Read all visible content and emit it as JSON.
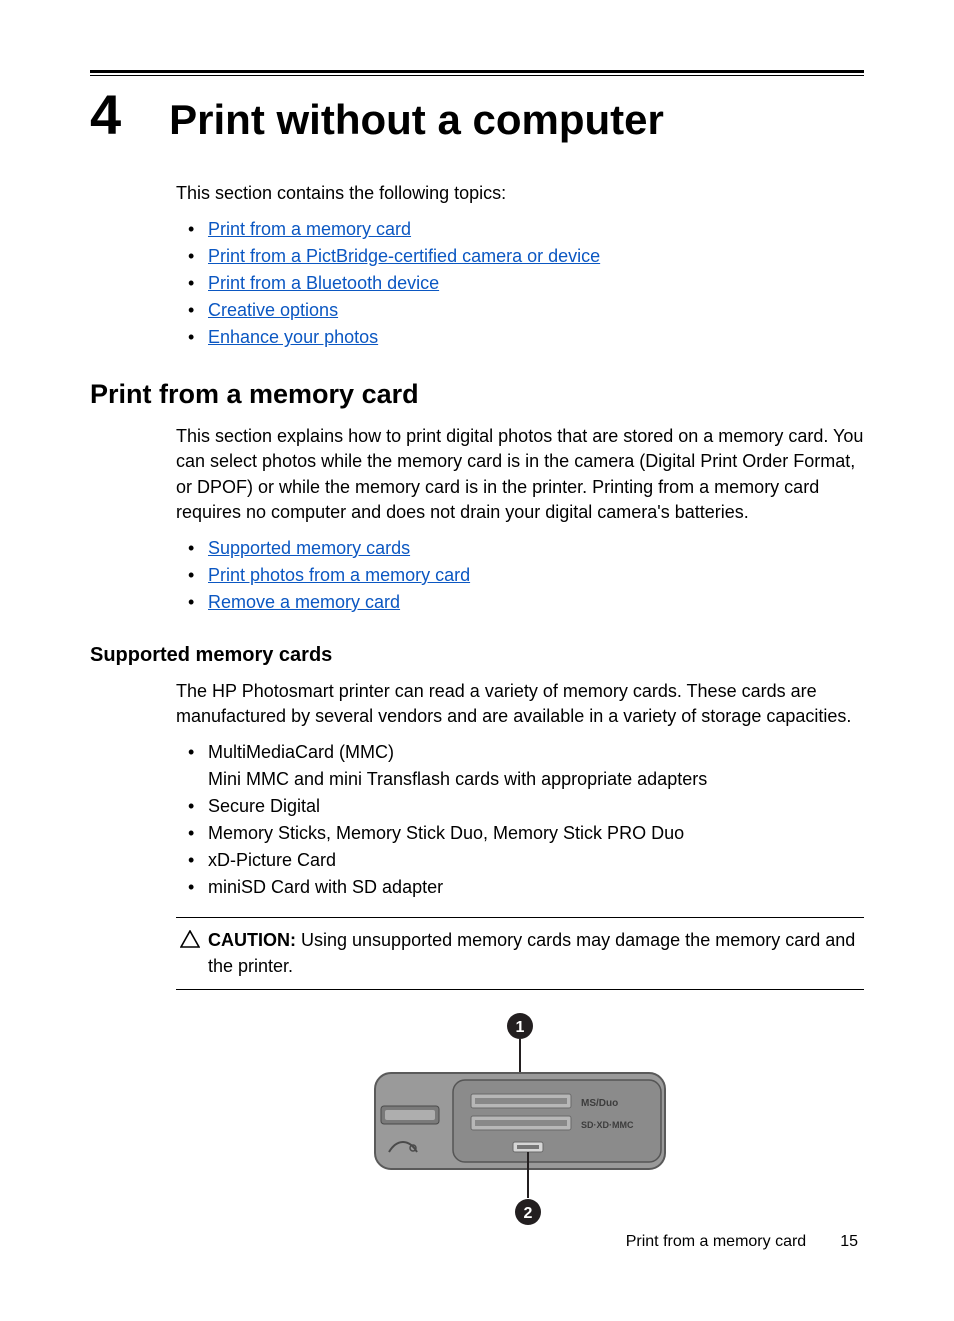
{
  "chapter": {
    "number": "4",
    "title": "Print without a computer"
  },
  "intro": "This section contains the following topics:",
  "topics": [
    "Print from a memory card",
    "Print from a PictBridge-certified camera or device",
    "Print from a Bluetooth device",
    "Creative options",
    "Enhance your photos"
  ],
  "section1": {
    "title": "Print from a memory card",
    "para": "This section explains how to print digital photos that are stored on a memory card. You can select photos while the memory card is in the camera (Digital Print Order Format, or DPOF) or while the memory card is in the printer. Printing from a memory card requires no computer and does not drain your digital camera's batteries.",
    "links": [
      "Supported memory cards",
      "Print photos from a memory card",
      "Remove a memory card"
    ]
  },
  "section2": {
    "title": "Supported memory cards",
    "para": "The HP Photosmart printer can read a variety of memory cards. These cards are manufactured by several vendors and are available in a variety of storage capacities.",
    "items": {
      "mmc_main": "MultiMediaCard (MMC)",
      "mmc_sub": "Mini MMC and mini Transflash cards with appropriate adapters",
      "sd": "Secure Digital",
      "ms": "Memory Sticks, Memory Stick Duo, Memory Stick PRO Duo",
      "xd": "xD-Picture Card",
      "mini": "miniSD Card with SD adapter"
    }
  },
  "caution": {
    "label": "CAUTION:",
    "text": " Using unsupported memory cards may damage the memory card and the printer."
  },
  "figure": {
    "callout1": "1",
    "callout2": "2",
    "label1": "MS/Duo",
    "label2": "SD·XD·MMC"
  },
  "footer": {
    "text": "Print from a memory card",
    "page": "15"
  }
}
